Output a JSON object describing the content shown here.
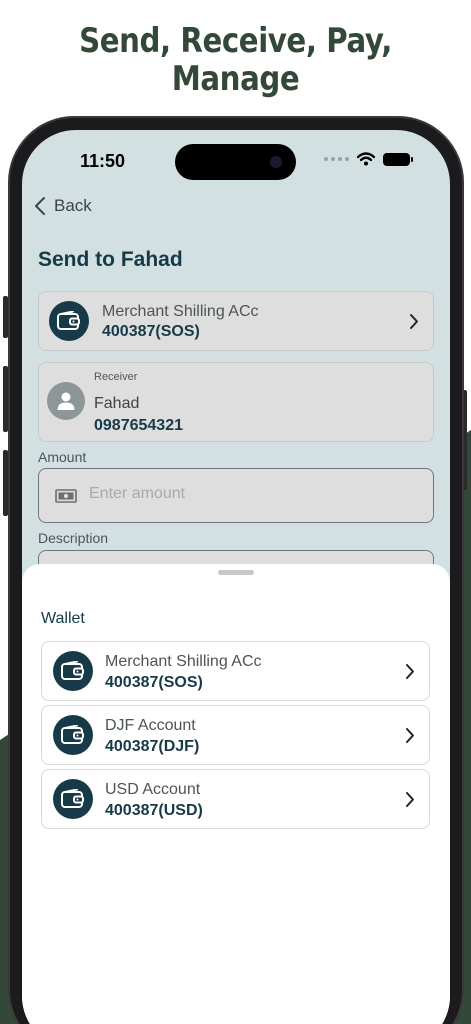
{
  "headline": {
    "line1": "Send, Receive, Pay,",
    "line2": "Manage"
  },
  "status_bar": {
    "time": "11:50"
  },
  "nav": {
    "back_label": "Back"
  },
  "page": {
    "title": "Send to Fahad"
  },
  "source_account": {
    "name": "Merchant Shilling ACc",
    "number": "400387(SOS)"
  },
  "receiver": {
    "label": "Receiver",
    "name": "Fahad",
    "phone": "0987654321"
  },
  "amount": {
    "label": "Amount",
    "placeholder": "Enter amount"
  },
  "description": {
    "label": "Description"
  },
  "wallet_sheet": {
    "title": "Wallet",
    "accounts": [
      {
        "name": "Merchant Shilling ACc",
        "number": "400387(SOS)"
      },
      {
        "name": "DJF Account",
        "number": "400387(DJF)"
      },
      {
        "name": "USD Account",
        "number": "400387(USD)"
      }
    ]
  },
  "colors": {
    "brand_dark": "#173a49",
    "headline_green": "#34483a",
    "screen_bg": "#d3e0e1"
  },
  "icons": [
    "chevron-left-icon",
    "wallet-icon",
    "chevron-right-icon",
    "user-icon",
    "cash-icon",
    "wifi-icon",
    "battery-icon",
    "signal-icon"
  ]
}
